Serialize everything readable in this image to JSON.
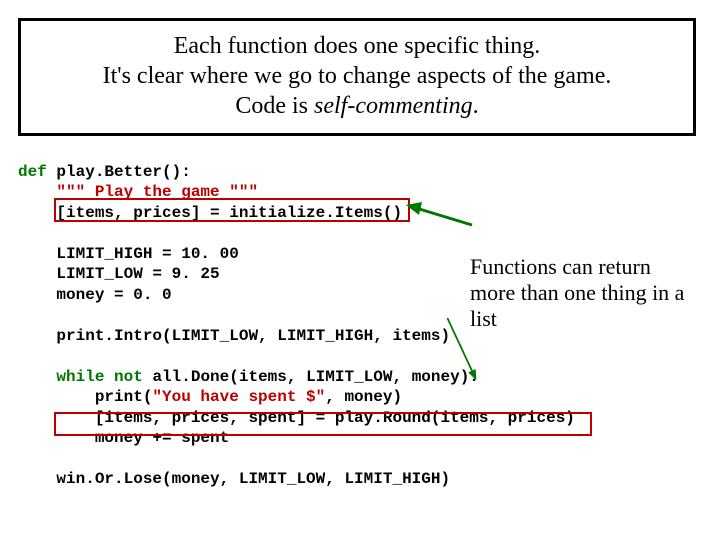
{
  "title": {
    "line1": "Each function does one specific thing.",
    "line2": "It's clear where we go to change aspects of the game.",
    "line3_pre": "Code is ",
    "line3_italic": "self-commenting",
    "line3_post": "."
  },
  "note": {
    "text": "Functions can return more than one thing in a list"
  },
  "code": {
    "l1_kw": "def",
    "l1_rest": " play.Better():",
    "l2_com": "    \"\"\" Play the game \"\"\"",
    "l3": "    [items, prices] = initialize.Items()",
    "blank": " ",
    "l4": "    LIMIT_HIGH = 10. 00",
    "l5": "    LIMIT_LOW = 9. 25",
    "l6": "    money = 0. 0",
    "l7": "    print.Intro(LIMIT_LOW, LIMIT_HIGH, items)",
    "l8_pre": "    ",
    "l8_kw1": "while",
    "l8_sp1": " ",
    "l8_kw2": "not",
    "l8_rest": " all.Done(items, LIMIT_LOW, money):",
    "l9_pre": "        print(",
    "l9_str": "\"You have spent $\"",
    "l9_post": ", money)",
    "l10": "        [items, prices, spent] = play.Round(items, prices)",
    "l11": "        money += spent",
    "l12": "    win.Or.Lose(money, LIMIT_LOW, LIMIT_HIGH)"
  }
}
